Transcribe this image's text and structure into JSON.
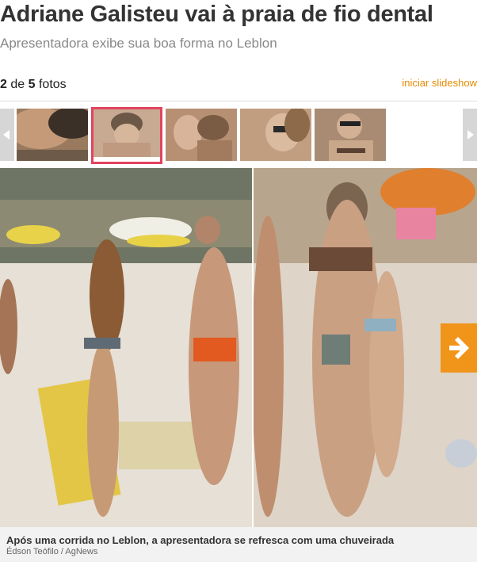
{
  "header": {
    "title": "Adriane Galisteu vai à praia de fio dental",
    "subtitle": "Apresentadora exibe sua boa forma no Leblon"
  },
  "gallery": {
    "current": "2",
    "separator": "de",
    "total": "5",
    "suffix": "fotos",
    "start_slideshow": "iniciar slideshow",
    "active_index": 2
  },
  "thumbnails": [
    {
      "icon": "photo-thumbnail-1"
    },
    {
      "icon": "photo-thumbnail-2"
    },
    {
      "icon": "photo-thumbnail-3"
    },
    {
      "icon": "photo-thumbnail-4"
    },
    {
      "icon": "photo-thumbnail-5"
    }
  ],
  "caption": {
    "text": "Após uma corrida no Leblon, a apresentadora se refresca com uma chuveirada",
    "credit": "Édson Teófilo / AgNews"
  },
  "colors": {
    "accent_orange": "#f0941a",
    "active_border": "#e2435f",
    "link": "#e58a00"
  }
}
